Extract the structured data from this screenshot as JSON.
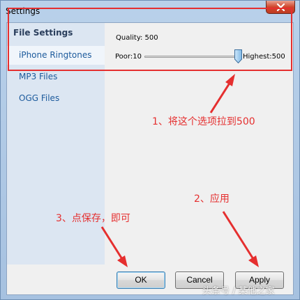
{
  "window": {
    "title": "Settings"
  },
  "sidebar": {
    "header": "File Settings",
    "items": [
      {
        "label": "iPhone Ringtones",
        "selected": true
      },
      {
        "label": "MP3 Files",
        "selected": false
      },
      {
        "label": "OGG Files",
        "selected": false
      }
    ]
  },
  "quality": {
    "label": "Quality: 500",
    "min_label": "Poor:10",
    "max_label": "Highest:500",
    "min": 10,
    "max": 500,
    "value": 500
  },
  "buttons": {
    "ok": "OK",
    "cancel": "Cancel",
    "apply": "Apply"
  },
  "annotations": {
    "step1": "1、将这个选项拉到500",
    "step2": "2、应用",
    "step3": "3、点保存，即可"
  },
  "watermark": "头条号 / 某他之家",
  "colors": {
    "annotation": "#e52f2f",
    "sidebar_bg": "#dce6f2",
    "link": "#1c5a9c"
  },
  "icons": {
    "close": "close-icon",
    "slider_thumb": "slider-thumb"
  }
}
